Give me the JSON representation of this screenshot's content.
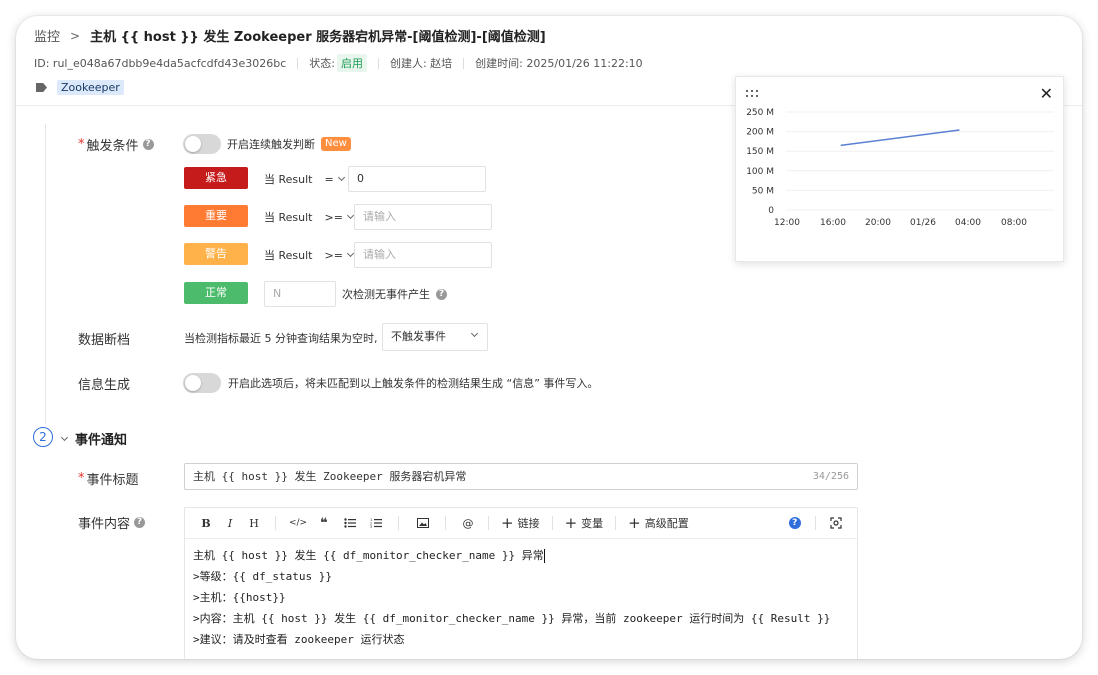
{
  "breadcrumb": {
    "parent": "监控",
    "current": "主机 {{ host }} 发生 Zookeeper 服务器宕机异常-[阈值检测]-[阈值检测]"
  },
  "meta": {
    "id": "ID: rul_e048a67dbb9e4da5acfcdfd43e3026bc",
    "status_label": "状态:",
    "status_value": "启用",
    "creator": "创建人: 赵培",
    "created_time": "创建时间: 2025/01/26 11:22:10"
  },
  "tag": "Zookeeper",
  "trigger": {
    "label": "触发条件",
    "continuous_label": "开启连续触发判断",
    "new_badge": "New",
    "rules": [
      {
        "level": "紧急",
        "color": "#c61b1b",
        "when": "当 Result",
        "op": "=",
        "value": "0",
        "placeholder": ""
      },
      {
        "level": "重要",
        "color": "#ff7a33",
        "when": "当 Result",
        "op": ">=",
        "value": "",
        "placeholder": "请输入"
      },
      {
        "level": "警告",
        "color": "#ffb14a",
        "when": "当 Result",
        "op": ">=",
        "value": "",
        "placeholder": "请输入"
      }
    ],
    "normal": {
      "level": "正常",
      "color": "#4cbb6c",
      "placeholder": "N",
      "suffix": "次检测无事件产生"
    }
  },
  "data_gap": {
    "label": "数据断档",
    "text": "当检测指标最近 5 分钟查询结果为空时,",
    "select": "不触发事件"
  },
  "info_gen": {
    "label": "信息生成",
    "text": "开启此选项后，将未匹配到以上触发条件的检测结果生成 “信息” 事件写入。"
  },
  "notify": {
    "step": "2",
    "title": "事件通知",
    "event_title_label": "事件标题",
    "event_title_value": "主机 {{ host }} 发生 Zookeeper 服务器宕机异常",
    "event_title_counter": "34/256",
    "content_label": "事件内容",
    "toolbar": {
      "link": "链接",
      "variable": "变量",
      "advanced": "高级配置"
    },
    "content_lines": [
      "主机 {{ host }} 发生 {{ df_monitor_checker_name }} 异常",
      ">等级：{{ df_status }}",
      ">主机：{{host}}",
      ">内容：主机 {{ host }} 发生 {{ df_monitor_checker_name }} 异常，当前 zookeeper 运行时间为 {{ Result }}",
      ">建议：请及时查看 zookeeper 运行状态"
    ]
  },
  "chart_data": {
    "type": "line",
    "title": "",
    "xlabel": "",
    "ylabel": "",
    "x_ticks": [
      "12:00",
      "16:00",
      "20:00",
      "01/26",
      "04:00",
      "08:00"
    ],
    "y_ticks": [
      "0",
      "50 M",
      "100 M",
      "150 M",
      "200 M",
      "250 M"
    ],
    "ylim": [
      0,
      250
    ],
    "grid": true,
    "series": [
      {
        "x": [
          "16:40",
          "03:00"
        ],
        "values": [
          165,
          204
        ],
        "color": "#5b7fd4"
      }
    ]
  }
}
